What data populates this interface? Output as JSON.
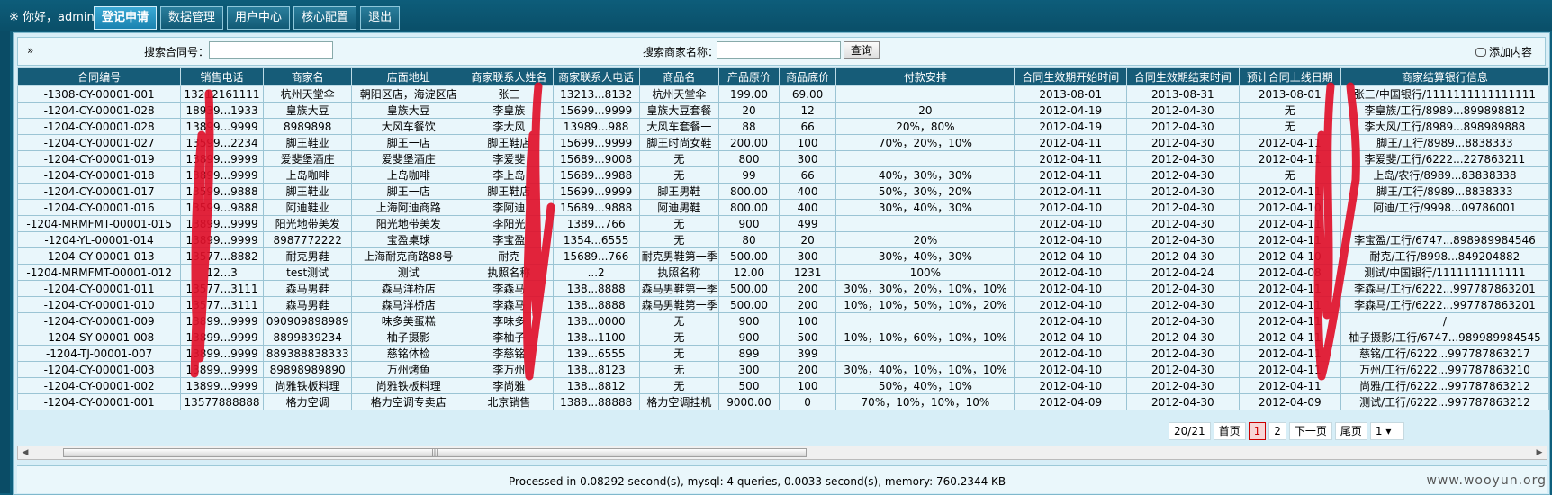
{
  "header": {
    "greeting": "※ 你好，admin",
    "menu": [
      "登记申请",
      "数据管理",
      "用户中心",
      "核心配置",
      "退出"
    ],
    "active_index": 0
  },
  "search": {
    "toggle": "»",
    "contract_label": "搜索合同号：",
    "contract_value": "",
    "merchant_label": "搜索商家名称：",
    "merchant_value": "",
    "button": "查询",
    "add_label": "添加内容"
  },
  "table": {
    "headers": [
      "合同编号",
      "销售电话",
      "商家名",
      "店面地址",
      "商家联系人姓名",
      "商家联系人电话",
      "商品名",
      "产品原价",
      "商品底价",
      "付款安排",
      "合同生效期开始时间",
      "合同生效期结束时间",
      "预计合同上线日期",
      "商家结算银行信息"
    ],
    "rows": [
      [
        "-1308-CY-00001-001",
        "13212161111",
        "杭州天堂伞",
        "朝阳区店，海淀区店",
        "张三",
        "13213...8132",
        "杭州天堂伞",
        "199.00",
        "69.00",
        "",
        "2013-08-01",
        "2013-08-31",
        "2013-08-01",
        "张三/中国银行/1111111111111111"
      ],
      [
        "-1204-CY-00001-028",
        "18939...1933",
        "皇族大豆",
        "皇族大豆",
        "李皇族",
        "15699...9999",
        "皇族大豆套餐",
        "20",
        "12",
        "20",
        "2012-04-19",
        "2012-04-30",
        "无",
        "李皇族/工行/8989...899898812"
      ],
      [
        "-1204-CY-00001-028",
        "13899...9999",
        "8989898",
        "大风车餐饮",
        "李大风",
        "13989...988",
        "大风车套餐一",
        "88",
        "66",
        "20%，80%",
        "2012-04-19",
        "2012-04-30",
        "无",
        "李大风/工行/8989...898989888"
      ],
      [
        "-1204-CY-00001-027",
        "13599...2234",
        "脚王鞋业",
        "脚王一店",
        "脚王鞋店",
        "15699...9999",
        "脚王时尚女鞋",
        "200.00",
        "100",
        "70%，20%，10%",
        "2012-04-11",
        "2012-04-30",
        "2012-04-11",
        "脚王/工行/8989...8838333"
      ],
      [
        "-1204-CY-00001-019",
        "13899...9999",
        "爱斐堡酒庄",
        "爱斐堡酒庄",
        "李爱斐",
        "15689...9008",
        "无",
        "800",
        "300",
        "",
        "2012-04-11",
        "2012-04-30",
        "2012-04-11",
        "李爱斐/工行/6222...227863211"
      ],
      [
        "-1204-CY-00001-018",
        "13899...9999",
        "上岛咖啡",
        "上岛咖啡",
        "李上岛",
        "15689...9988",
        "无",
        "99",
        "66",
        "40%，30%，30%",
        "2012-04-11",
        "2012-04-30",
        "无",
        "上岛/农行/8989...83838338"
      ],
      [
        "-1204-CY-00001-017",
        "13599...9888",
        "脚王鞋业",
        "脚王一店",
        "脚王鞋店",
        "15699...9999",
        "脚王男鞋",
        "800.00",
        "400",
        "50%，30%，20%",
        "2012-04-11",
        "2012-04-30",
        "2012-04-11",
        "脚王/工行/8989...8838333"
      ],
      [
        "-1204-CY-00001-016",
        "13599...9888",
        "阿迪鞋业",
        "上海阿迪商路",
        "李阿迪",
        "15689...9888",
        "阿迪男鞋",
        "800.00",
        "400",
        "30%，40%，30%",
        "2012-04-10",
        "2012-04-30",
        "2012-04-10",
        "阿迪/工行/9998...09786001"
      ],
      [
        "-1204-MRMFMT-00001-015",
        "13899...9999",
        "阳光地带美发",
        "阳光地带美发",
        "李阳光",
        "1389...766",
        "无",
        "900",
        "499",
        "",
        "2012-04-10",
        "2012-04-30",
        "2012-04-11",
        ""
      ],
      [
        "-1204-YL-00001-014",
        "13899...9999",
        "8987772222",
        "宝盈桌球",
        "李宝盈",
        "1354...6555",
        "无",
        "80",
        "20",
        "20%",
        "2012-04-10",
        "2012-04-30",
        "2012-04-11",
        "李宝盈/工行/6747...898989984546"
      ],
      [
        "-1204-CY-00001-013",
        "13577...8882",
        "耐克男鞋",
        "上海耐克商路88号",
        "耐克",
        "15689...766",
        "耐克男鞋第一季",
        "500.00",
        "300",
        "30%，40%，30%",
        "2012-04-10",
        "2012-04-30",
        "2012-04-10",
        "耐克/工行/8998...849204882"
      ],
      [
        "-1204-MRMFMT-00001-012",
        "12...3",
        "test测试",
        "测试",
        "执照名称",
        "...2",
        "执照名称",
        "12.00",
        "1231",
        "100%",
        "2012-04-10",
        "2012-04-24",
        "2012-04-08",
        "测试/中国银行/1111111111111"
      ],
      [
        "-1204-CY-00001-011",
        "13577...3111",
        "森马男鞋",
        "森马洋桥店",
        "李森马",
        "138...8888",
        "森马男鞋第一季",
        "500.00",
        "200",
        "30%，30%，20%，10%，10%",
        "2012-04-10",
        "2012-04-30",
        "2012-04-11",
        "李森马/工行/6222...997787863201"
      ],
      [
        "-1204-CY-00001-010",
        "13577...3111",
        "森马男鞋",
        "森马洋桥店",
        "李森马",
        "138...8888",
        "森马男鞋第一季",
        "500.00",
        "200",
        "10%，10%，50%，10%，20%",
        "2012-04-10",
        "2012-04-30",
        "2012-04-11",
        "李森马/工行/6222...997787863201"
      ],
      [
        "-1204-CY-00001-009",
        "13899...9999",
        "090909898989",
        "味多美蛋糕",
        "李味多",
        "138...0000",
        "无",
        "900",
        "100",
        "",
        "2012-04-10",
        "2012-04-30",
        "2012-04-11",
        "/"
      ],
      [
        "-1204-SY-00001-008",
        "13899...9999",
        "8899839234",
        "柚子摄影",
        "李柚子",
        "138...1100",
        "无",
        "900",
        "500",
        "10%，10%，60%，10%，10%",
        "2012-04-10",
        "2012-04-30",
        "2012-04-11",
        "柚子摄影/工行/6747...989989984545"
      ],
      [
        "-1204-TJ-00001-007",
        "13899...9999",
        "889388838333",
        "慈铭体检",
        "李慈铭",
        "139...6555",
        "无",
        "899",
        "399",
        "",
        "2012-04-10",
        "2012-04-30",
        "2012-04-11",
        "慈铭/工行/6222...997787863217"
      ],
      [
        "-1204-CY-00001-003",
        "13899...9999",
        "89898989890",
        "万州烤鱼",
        "李万州",
        "138...8123",
        "无",
        "300",
        "200",
        "30%，40%，10%，10%，10%",
        "2012-04-10",
        "2012-04-30",
        "2012-04-11",
        "万州/工行/6222...997787863210"
      ],
      [
        "-1204-CY-00001-002",
        "13899...9999",
        "尚雅铁板料理",
        "尚雅铁板料理",
        "李尚雅",
        "138...8812",
        "无",
        "500",
        "100",
        "50%，40%，10%",
        "2012-04-10",
        "2012-04-30",
        "2012-04-11",
        "尚雅/工行/6222...997787863212"
      ],
      [
        "-1204-CY-00001-001",
        "13577888888",
        "格力空调",
        "格力空调专卖店",
        "北京销售",
        "1388...88888",
        "格力空调挂机",
        "9000.00",
        "0",
        "70%，10%，10%，10%",
        "2012-04-09",
        "2012-04-30",
        "2012-04-09",
        "测试/工行/6222...997787863212"
      ]
    ]
  },
  "pager": {
    "count": "20/21",
    "first": "首页",
    "pages": [
      "1",
      "2"
    ],
    "current": "1",
    "next": "下一页",
    "last": "尾页",
    "select_value": "1 ▾"
  },
  "footer": {
    "text": "Processed in 0.08292 second(s), mysql: 4 queries, 0.0033 second(s), memory: 760.2344 KB"
  },
  "watermark": "www.wooyun.org",
  "colors": {
    "header_bg": "#165c78",
    "top_bg": "#0d5d7a",
    "row_bg": "#e9f6fb",
    "redact": "#e0102a"
  }
}
